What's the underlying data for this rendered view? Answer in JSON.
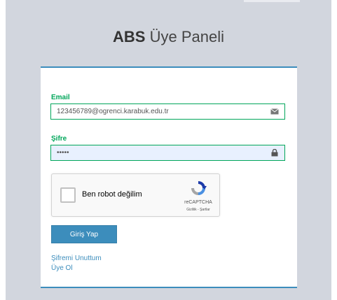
{
  "header": {
    "brand_bold": "ABS",
    "brand_rest": " Üye Paneli"
  },
  "form": {
    "email_label": "Email",
    "email_value": "123456789@ogrenci.karabuk.edu.tr",
    "password_label": "Şifre",
    "password_value": "•••••",
    "email_icon": "envelope-icon",
    "password_icon": "lock-icon"
  },
  "captcha": {
    "label": "Ben robot değilim",
    "brand": "reCAPTCHA",
    "terms": "Gizlilik - Şartlar",
    "checked": false
  },
  "actions": {
    "login_label": "Giriş Yap",
    "forgot_label": "Şifremi Unuttum",
    "register_label": "Üye Ol"
  },
  "colors": {
    "accent": "#3c8dbc",
    "field_border": "#00a65a",
    "background": "#d2d6de"
  }
}
